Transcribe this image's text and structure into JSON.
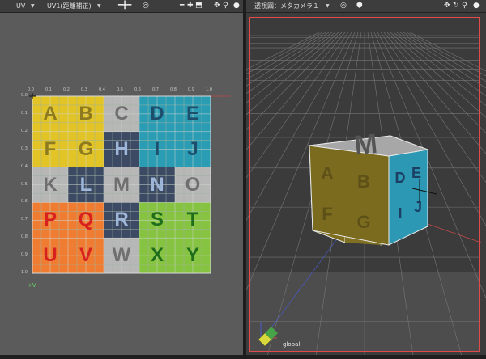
{
  "left_view": {
    "mode_label": "UV",
    "map_label": "UV1(距離補正)",
    "v_axis_label": "+V",
    "x_ticks": [
      "0.0",
      "0.1",
      "0.2",
      "0.3",
      "0.4",
      "0.5",
      "0.6",
      "0.7",
      "0.8",
      "0.9",
      "1.0"
    ],
    "y_ticks": [
      "0.0",
      "0.1",
      "0.2",
      "0.3",
      "0.4",
      "0.5",
      "0.6",
      "0.7",
      "0.8",
      "0.9",
      "1.0"
    ],
    "letters": [
      "A",
      "B",
      "C",
      "D",
      "E",
      "F",
      "G",
      "H",
      "I",
      "J",
      "K",
      "L",
      "M",
      "N",
      "O",
      "P",
      "Q",
      "R",
      "S",
      "T",
      "U",
      "V",
      "W",
      "X",
      "Y"
    ],
    "colors": {
      "yellow": "#e3c426",
      "gray": "#b7b7b7",
      "cyan": "#2a9cb4",
      "navy": "#3d4a64",
      "orange": "#f07c31",
      "green": "#86c341"
    }
  },
  "right_view": {
    "view_label": "透視図：メタカメラ１",
    "cube_top_letter": "M",
    "cube_front_letters": [
      "A",
      "B",
      "F",
      "G"
    ],
    "cube_side_letters": [
      "D",
      "E",
      "I",
      "J"
    ],
    "coord_label": "global",
    "frame_color": "#e14b4b"
  }
}
